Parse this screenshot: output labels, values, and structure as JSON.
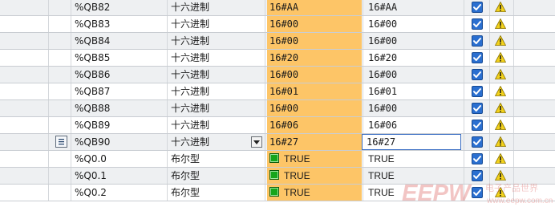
{
  "rows": [
    {
      "name": "%QB82",
      "format": "十六进制",
      "monitor": "16#AA",
      "modify": "16#AA",
      "kind": "hex"
    },
    {
      "name": "%QB83",
      "format": "十六进制",
      "monitor": "16#00",
      "modify": "16#00",
      "kind": "hex"
    },
    {
      "name": "%QB84",
      "format": "十六进制",
      "monitor": "16#00",
      "modify": "16#00",
      "kind": "hex"
    },
    {
      "name": "%QB85",
      "format": "十六进制",
      "monitor": "16#20",
      "modify": "16#20",
      "kind": "hex"
    },
    {
      "name": "%QB86",
      "format": "十六进制",
      "monitor": "16#00",
      "modify": "16#00",
      "kind": "hex"
    },
    {
      "name": "%QB87",
      "format": "十六进制",
      "monitor": "16#01",
      "modify": "16#01",
      "kind": "hex"
    },
    {
      "name": "%QB88",
      "format": "十六进制",
      "monitor": "16#00",
      "modify": "16#00",
      "kind": "hex"
    },
    {
      "name": "%QB89",
      "format": "十六进制",
      "monitor": "16#06",
      "modify": "16#06",
      "kind": "hex"
    },
    {
      "name": "%QB90",
      "format": "十六进制",
      "monitor": "16#27",
      "modify": "16#27",
      "kind": "hex",
      "selected": true
    },
    {
      "name": "%Q0.0",
      "format": "布尔型",
      "monitor": "TRUE",
      "modify": "TRUE",
      "kind": "bool"
    },
    {
      "name": "%Q0.1",
      "format": "布尔型",
      "monitor": "TRUE",
      "modify": "TRUE",
      "kind": "bool"
    },
    {
      "name": "%Q0.2",
      "format": "布尔型",
      "monitor": "TRUE",
      "modify": "TRUE",
      "kind": "bool"
    }
  ],
  "colors": {
    "monitor_bg": "#fdc567",
    "checkbox": "#2a6fd0",
    "warning": "#f3d21b",
    "led_true": "#16a51b"
  },
  "icons": {
    "row_icon": "list-icon",
    "dropdown": "chevron-down-icon",
    "check": "checkbox-checked-icon",
    "warn": "warning-icon"
  },
  "watermark": {
    "text": "EEPW",
    "sub": "电子产品世界",
    "url": "www.eepw.com.cn"
  }
}
